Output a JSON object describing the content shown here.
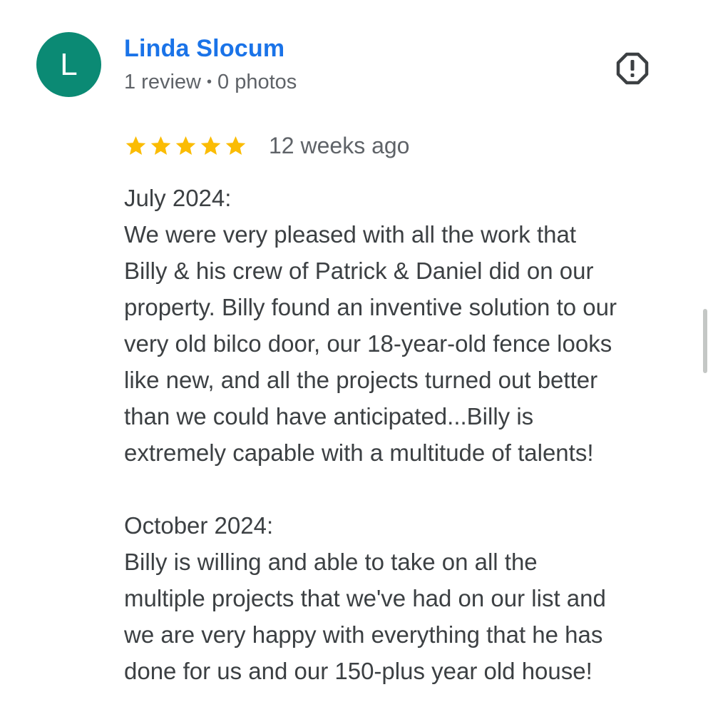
{
  "reviewer": {
    "initial": "L",
    "name": "Linda Slocum",
    "reviews": "1 review",
    "separator": "•",
    "photos": "0 photos"
  },
  "review": {
    "rating": 5,
    "rating_max": 5,
    "date": "12 weeks ago",
    "lines": [
      "July 2024:",
      "We were very pleased with all the work that",
      "Billy & his crew of Patrick & Daniel did on our",
      "property. Billy found an inventive solution to our",
      "very old bilco door, our 18-year-old fence looks",
      "like new, and all the projects turned out better",
      "than we could have anticipated...Billy is",
      "extremely capable with a multitude of talents!",
      "",
      "October 2024:",
      "Billy is willing and able to take on all the",
      "multiple projects that we've had on our list and",
      "we are very happy with everything that he has",
      "done for us and our 150-plus year old house!"
    ]
  },
  "icons": {
    "report": "report-flag-icon",
    "star": "star-icon"
  },
  "colors": {
    "avatar_bg": "#0b8a74",
    "name_link": "#1a73e8",
    "star": "#fbbc04",
    "text": "#3c4043",
    "secondary_text": "#5f6368",
    "report_icon": "#3c4043",
    "scrollbar": "#c4c7c5"
  }
}
